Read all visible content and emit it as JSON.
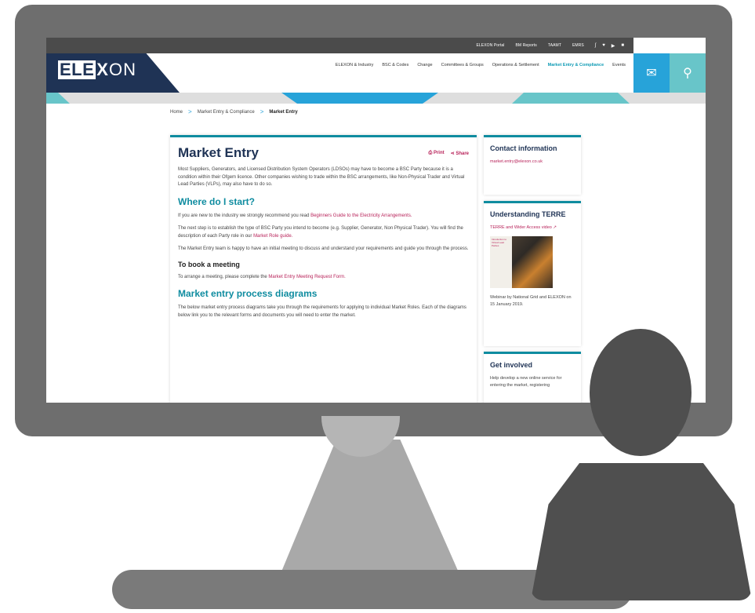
{
  "topbar": {
    "links": [
      "ELEXON Portal",
      "BM Reports",
      "TAAMT",
      "EMRS"
    ],
    "social_icons": [
      "flickr-icon",
      "twitter-icon",
      "youtube-icon",
      "linkedin-icon"
    ]
  },
  "logo": {
    "part1": "ELE",
    "part2": "X",
    "part3": "ON"
  },
  "mainnav": {
    "items": [
      "ELEXON & Industry",
      "BSC & Codes",
      "Change",
      "Committees & Groups",
      "Operations & Settlement",
      "Market Entry & Compliance",
      "Events"
    ],
    "active_index": 5
  },
  "breadcrumb": {
    "home": "Home",
    "section": "Market Entry & Compliance",
    "current": "Market Entry",
    "sep": ">"
  },
  "main": {
    "title": "Market Entry",
    "print_label": "Print",
    "share_label": "Share",
    "intro": "Most Suppliers, Generators, and Licensed Distribution System Operators (LDSOs) may have to become a BSC Party because it is a condition within their Ofgem licence. Other companies wishing to trade within the BSC arrangements, like Non-Physical Trader and Virtual Lead Parties (VLPs), may also have to do so.",
    "where_title": "Where do I start?",
    "where_p1_pre": "If you are new to the industry we strongly recommend you read ",
    "where_p1_link": "Beginners Guide to the Electricity Arrangements.",
    "where_p2_pre": "The next step is to establish the type of BSC Party you intend to become (e.g. Supplier, Generator, Non Physical Trader). You will find the description of each Party role in our ",
    "where_p2_link": "Market Role guide.",
    "where_p3": "The Market Entry team is happy to have an initial meeting to discuss and understand your requirements and guide you through the process.",
    "book_title": "To book a meeting",
    "book_pre": "To arrange a meeting, please complete the ",
    "book_link": "Market Entry Meeting Request Form.",
    "diagrams_title": "Market entry process diagrams",
    "diagrams_p": "The below market entry process diagrams take you through the requirements for applying to individual Market Roles. Each of the diagrams below link you to the relevant forms and documents you will need to enter the market."
  },
  "sidebar": {
    "contact_title": "Contact information",
    "contact_email": "market.entry@elexon.co.uk",
    "terre_title": "Understanding TERRE",
    "terre_link": "TERRE and Wider Access video ↗",
    "thumb_text": "Introduction to Virtual Lead Parties",
    "terre_caption": "Webinar by National Grid and ELEXON on 15 January 2019.",
    "involved_title": "Get involved",
    "involved_text": "Help develop a new online service for entering the market, registering"
  },
  "colors": {
    "navy": "#1f3355",
    "teal": "#0f8ca0",
    "blue": "#27a3d9",
    "magenta": "#b8235a"
  }
}
